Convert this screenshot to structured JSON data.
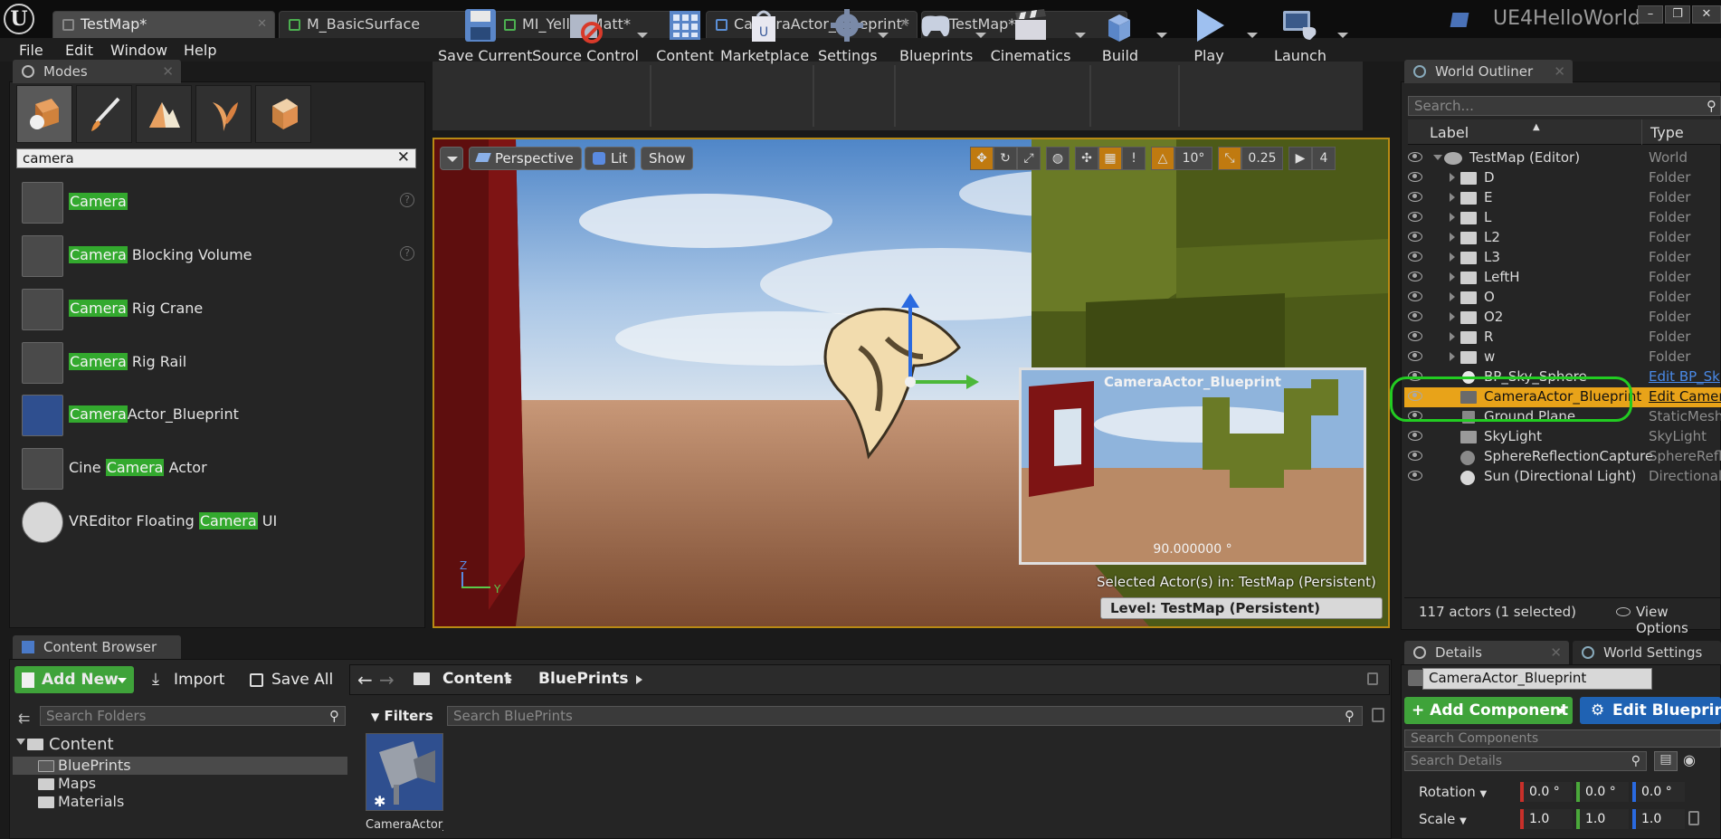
{
  "title_bar": {
    "tabs": [
      {
        "label": "TestMap*"
      },
      {
        "label": "M_BasicSurface"
      },
      {
        "label": "MI_YellowMatt*"
      },
      {
        "label": "CameraActor_Blueprint*"
      },
      {
        "label": "TestMap*"
      }
    ],
    "project_name": "UE4HelloWorld",
    "logo": "U"
  },
  "menu": {
    "items": [
      "File",
      "Edit",
      "Window",
      "Help"
    ]
  },
  "modes": {
    "tab_label": "Modes",
    "search_value": "camera",
    "items": [
      {
        "match": "Camera",
        "rest": ""
      },
      {
        "match": "Camera",
        "rest": " Blocking Volume"
      },
      {
        "match": "Camera",
        "rest": " Rig Crane"
      },
      {
        "match": "Camera",
        "rest": " Rig Rail"
      },
      {
        "match": "Camera",
        "rest": "Actor_Blueprint"
      },
      {
        "prefix": "Cine ",
        "match": "Camera",
        "rest": " Actor"
      },
      {
        "prefix": "VREditor Floating ",
        "match": "Camera",
        "rest": " UI"
      }
    ]
  },
  "toolbar": {
    "buttons": [
      {
        "label": "Save Current"
      },
      {
        "label": "Source Control"
      },
      {
        "label": "Content"
      },
      {
        "label": "Marketplace"
      },
      {
        "label": "Settings"
      },
      {
        "label": "Blueprints"
      },
      {
        "label": "Cinematics"
      },
      {
        "label": "Build"
      },
      {
        "label": "Play"
      },
      {
        "label": "Launch"
      }
    ]
  },
  "viewport": {
    "perspective_label": "Perspective",
    "lit_label": "Lit",
    "show_label": "Show",
    "rotation_snap": "10°",
    "scale_snap": "0.25",
    "camera_speed": "4",
    "preview_title": "CameraActor_Blueprint",
    "preview_fov": "90.000000 °",
    "selected_actors_text": "Selected Actor(s) in:  TestMap (Persistent)",
    "level_text": "Level:  TestMap (Persistent)",
    "axis_z": "Z",
    "axis_y": "Y"
  },
  "outliner": {
    "tab_label": "World Outliner",
    "search_placeholder": "Search...",
    "col_label": "Label",
    "col_type": "Type",
    "rows": [
      {
        "label": "TestMap (Editor)",
        "type": "World"
      },
      {
        "label": "D",
        "type": "Folder"
      },
      {
        "label": "E",
        "type": "Folder"
      },
      {
        "label": "L",
        "type": "Folder"
      },
      {
        "label": "L2",
        "type": "Folder"
      },
      {
        "label": "L3",
        "type": "Folder"
      },
      {
        "label": "LeftH",
        "type": "Folder"
      },
      {
        "label": "O",
        "type": "Folder"
      },
      {
        "label": "O2",
        "type": "Folder"
      },
      {
        "label": "R",
        "type": "Folder"
      },
      {
        "label": "w",
        "type": "Folder"
      },
      {
        "label": "BP_Sky_Sphere",
        "type": "Edit BP_Sk"
      },
      {
        "label": "CameraActor_Blueprint",
        "type": "Edit Camer"
      },
      {
        "label": "Ground Plane",
        "type": "StaticMesh/"
      },
      {
        "label": "SkyLight",
        "type": "SkyLight"
      },
      {
        "label": "SphereReflectionCapture",
        "type": "SphereRefle"
      },
      {
        "label": "Sun (Directional Light)",
        "type": "DirectionalL"
      }
    ],
    "footer_count": "117 actors (1 selected)",
    "view_options": "View Options"
  },
  "content_browser": {
    "tab_label": "Content Browser",
    "add_new": "Add New",
    "import": "Import",
    "save_all": "Save All",
    "breadcrumb": [
      "Content",
      "BluePrints"
    ],
    "search_folders_placeholder": "Search Folders",
    "filters_label": "Filters",
    "search_assets_placeholder": "Search BluePrints",
    "tree": [
      {
        "label": "Content"
      },
      {
        "label": "BluePrints"
      },
      {
        "label": "Maps"
      },
      {
        "label": "Materials"
      }
    ],
    "asset_label": "CameraActor_..."
  },
  "details": {
    "tab_details": "Details",
    "tab_world_settings": "World Settings",
    "actor_name": "CameraActor_Blueprint",
    "add_component": "Add Component",
    "edit_blueprint": "Edit Blueprin",
    "search_components_placeholder": "Search Components",
    "search_details_placeholder": "Search Details",
    "rotation_label": "Rotation",
    "rotation_values": [
      "0.0 °",
      "0.0 °",
      "0.0 °"
    ],
    "scale_label": "Scale",
    "scale_values": [
      "1.0",
      "1.0",
      "1.0"
    ]
  },
  "colors": {
    "selection_orange": "#e8a319",
    "highlight_green": "#33a92e",
    "viewport_border": "#b88a14",
    "add_green": "#3fa33a",
    "edit_blue": "#1f62b3"
  }
}
